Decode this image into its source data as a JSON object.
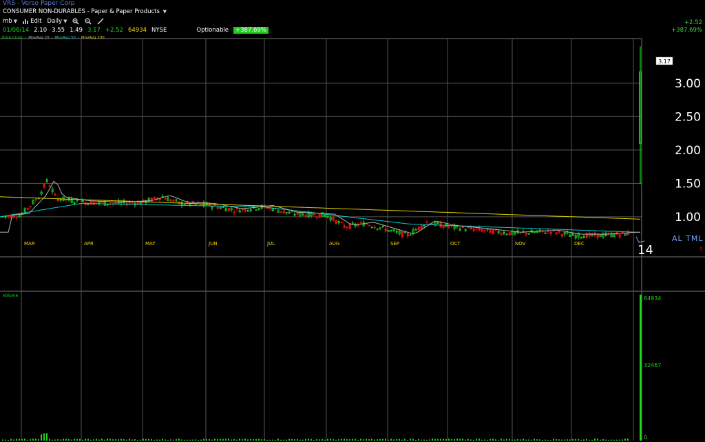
{
  "header": {
    "title": "VRS - Verso Paper Corp",
    "sector": "CONSUMER NON-DURABLES",
    "industry": "Paper & Paper Products"
  },
  "toolbar": {
    "layout": "mb",
    "edit": "Edit",
    "period": "Daily"
  },
  "quote": {
    "date": "01/06/14",
    "open": "2.10",
    "high": "3.55",
    "low": "1.49",
    "last": "3.17",
    "change": "+2.52",
    "volume": "64934",
    "exchange": "NYSE",
    "optionable": "Optionable",
    "pct_change": "+387.69%"
  },
  "top_right": {
    "change": "+2.52",
    "pct_change": "+387.69%"
  },
  "legend": {
    "price": "Price Chart",
    "ma20": "MovAvg 20",
    "ma50": "MovAvg 50",
    "ma200": "MovAvg 200"
  },
  "volume_panel": {
    "label": "Volume",
    "max": "64934",
    "mid": "32467",
    "min": "0"
  },
  "axis": {
    "price_labels": [
      "3.00",
      "2.50",
      "2.00",
      "1.50",
      "1.00"
    ],
    "months": [
      "MAR",
      "APR",
      "MAY",
      "JUN",
      "JUL",
      "AUG",
      "SEP",
      "OCT",
      "NOV",
      "DEC"
    ],
    "year": "14",
    "last_price_box": "3.17"
  },
  "extra": {
    "al_text": "AL TML",
    "red_mark": "5"
  },
  "colors": {
    "up": "#1dd61d",
    "down": "#e01010",
    "ma20": "#b0b0b0",
    "ma50": "#00d0d0",
    "ma200": "#e0d000",
    "grid": "#555555"
  },
  "chart_data": {
    "type": "line",
    "title": "VRS - Verso Paper Corp",
    "xlabel": "",
    "ylabel": "",
    "ylim": [
      0.5,
      3.5
    ],
    "x": [
      "MAR",
      "APR",
      "MAY",
      "JUN",
      "JUL",
      "AUG",
      "SEP",
      "OCT",
      "NOV",
      "DEC",
      "14"
    ],
    "series": [
      {
        "name": "Price Chart",
        "values": [
          1.05,
          1.3,
          1.2,
          1.2,
          1.15,
          0.95,
          0.8,
          0.92,
          0.78,
          0.72,
          3.17
        ]
      },
      {
        "name": "MovAvg 50",
        "values": [
          1.0,
          1.2,
          1.2,
          1.15,
          1.12,
          1.05,
          0.9,
          0.88,
          0.82,
          0.78,
          0.78
        ]
      },
      {
        "name": "MovAvg 200",
        "values": [
          1.3,
          1.27,
          1.25,
          1.22,
          1.18,
          1.14,
          1.1,
          1.06,
          1.03,
          0.99,
          0.96
        ]
      }
    ],
    "volume_max": 64934
  }
}
